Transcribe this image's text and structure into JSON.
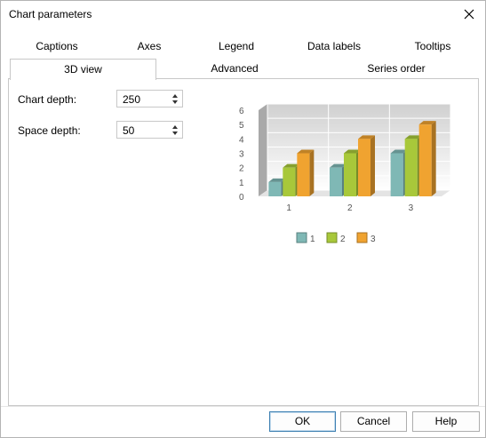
{
  "window": {
    "title": "Chart parameters"
  },
  "tabs_row1": [
    "Captions",
    "Axes",
    "Legend",
    "Data labels",
    "Tooltips"
  ],
  "tabs_row2": [
    "3D view",
    "Advanced",
    "Series order"
  ],
  "selected_tab": "3D view",
  "fields": {
    "chart_depth": {
      "label": "Chart depth:",
      "value": "250"
    },
    "space_depth": {
      "label": "Space depth:",
      "value": "50"
    }
  },
  "buttons": {
    "ok": "OK",
    "cancel": "Cancel",
    "help": "Help"
  },
  "chart_data": {
    "type": "bar",
    "title": "",
    "xlabel": "",
    "ylabel": "",
    "categories": [
      "1",
      "2",
      "3"
    ],
    "ylim": [
      0,
      6
    ],
    "yticks": [
      "0",
      "1",
      "2",
      "3",
      "4",
      "5",
      "6"
    ],
    "series": [
      {
        "name": "1",
        "values": [
          1,
          2,
          3
        ],
        "color": "#7fb8b5"
      },
      {
        "name": "2",
        "values": [
          2,
          3,
          4
        ],
        "color": "#a8c83a"
      },
      {
        "name": "3",
        "values": [
          3,
          4,
          5
        ],
        "color": "#f0a330"
      }
    ],
    "grid": true,
    "three_d": true,
    "legend_position": "bottom"
  }
}
